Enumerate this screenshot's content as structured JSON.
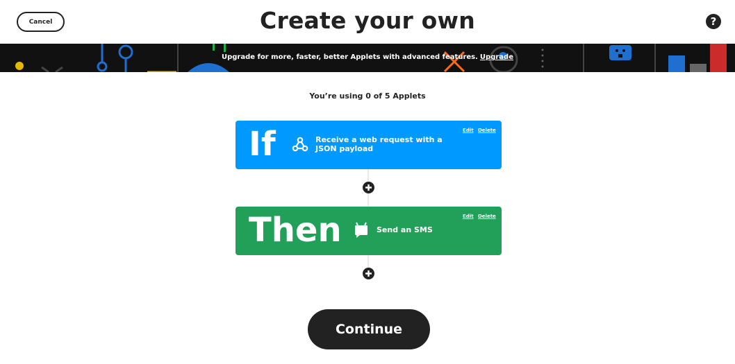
{
  "header": {
    "cancel_label": "Cancel",
    "title": "Create your own",
    "help_icon": "question-circle-icon",
    "help_glyph": "?"
  },
  "banner": {
    "message": "Upgrade for more, faster, better Applets with advanced features.",
    "upgrade_label": "Upgrade"
  },
  "usage": {
    "text": "You’re using 0 of 5 Applets"
  },
  "if_card": {
    "keyword": "If",
    "icon": "webhooks-icon",
    "action": "Receive a web request with a JSON payload",
    "edit_label": "Edit",
    "delete_label": "Delete",
    "color": "#0099ff"
  },
  "then_card": {
    "keyword": "Then",
    "icon": "android-sms-icon",
    "action": "Send an SMS",
    "edit_label": "Edit",
    "delete_label": "Delete",
    "color": "#22a05a"
  },
  "add_buttons": {
    "icon": "plus-circle-icon"
  },
  "footer": {
    "continue_label": "Continue"
  }
}
